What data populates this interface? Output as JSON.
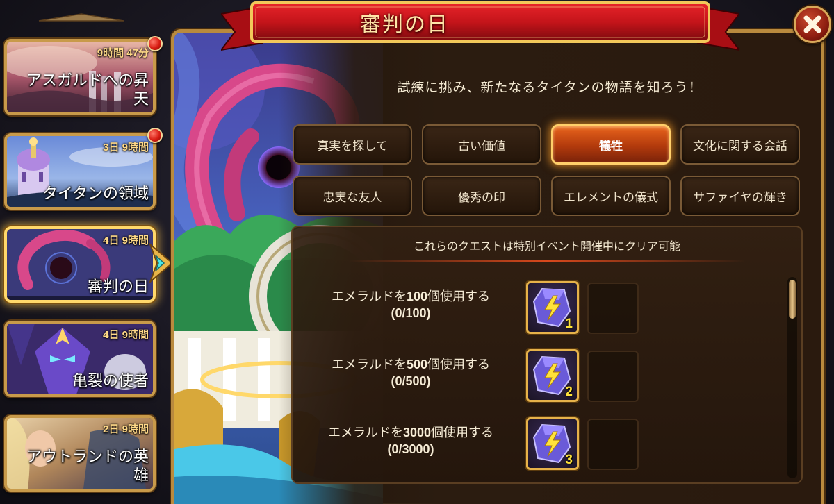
{
  "sidebar": {
    "events": [
      {
        "timer": "9時間 47分",
        "title": "アスガルドへの昇天",
        "notification": true
      },
      {
        "timer": "3日 9時間",
        "title": "タイタンの領域",
        "notification": true
      },
      {
        "timer": "4日 9時間",
        "title": "審判の日",
        "notification": false,
        "active": true
      },
      {
        "timer": "4日 9時間",
        "title": "亀裂の使者",
        "notification": false
      },
      {
        "timer": "2日 9時間",
        "title": "アウトランドの英雄",
        "notification": false
      }
    ]
  },
  "header": {
    "title": "審判の日",
    "close_icon": "close-x-icon"
  },
  "main": {
    "subtitle": "試練に挑み、新たなるタイタンの物語を知ろう！",
    "tabs": [
      {
        "label": "真実を探して"
      },
      {
        "label": "古い価値"
      },
      {
        "label": "犠牲",
        "active": true
      },
      {
        "label": "文化に関する会話"
      },
      {
        "label": "忠実な友人"
      },
      {
        "label": "優秀の印"
      },
      {
        "label": "エレメントの儀式"
      },
      {
        "label": "サファイヤの輝き"
      }
    ],
    "quests_header": "これらのクエストは特別イベント開催中にクリア可能",
    "quests": [
      {
        "text_prefix": "エメラルドを",
        "amount": "100",
        "text_suffix": "個使用する",
        "progress": "(0/100)",
        "reward_icon": "lightning-stone-icon",
        "reward_count": "1"
      },
      {
        "text_prefix": "エメラルドを",
        "amount": "500",
        "text_suffix": "個使用する",
        "progress": "(0/500)",
        "reward_icon": "lightning-stone-icon",
        "reward_count": "2"
      },
      {
        "text_prefix": "エメラルドを",
        "amount": "3000",
        "text_suffix": "個使用する",
        "progress": "(0/3000)",
        "reward_icon": "lightning-stone-icon",
        "reward_count": "3"
      }
    ]
  },
  "colors": {
    "frame_gold": "#c89a4a",
    "ribbon_red": "#c4141a",
    "tab_active": "#d4501a",
    "panel_bg": "#2a1a0e",
    "notification_red": "#d81c12"
  }
}
